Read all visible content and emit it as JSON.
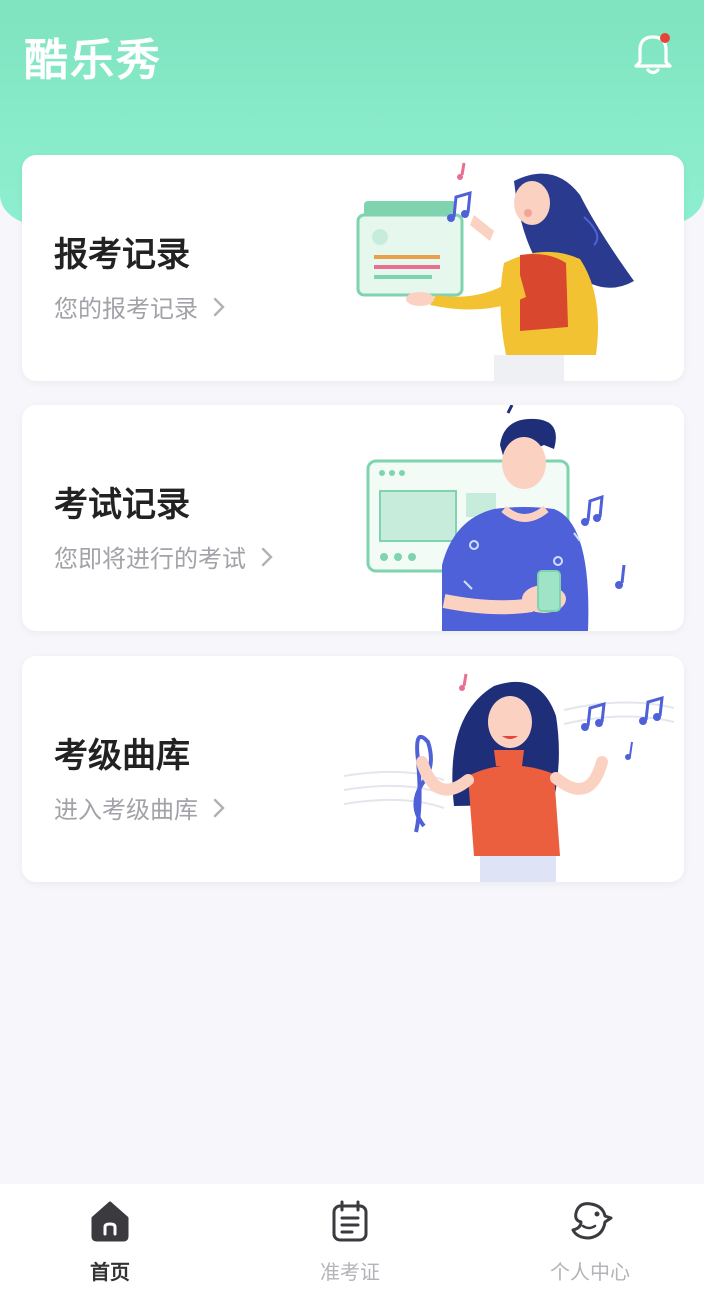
{
  "header": {
    "app_title": "酷乐秀",
    "bell_has_notification": true
  },
  "cards": [
    {
      "title": "报考记录",
      "subtitle": "您的报考记录"
    },
    {
      "title": "考试记录",
      "subtitle": "您即将进行的考试"
    },
    {
      "title": "考级曲库",
      "subtitle": "进入考级曲库"
    }
  ],
  "tabbar": {
    "tabs": [
      {
        "label": "首页",
        "icon": "home-icon",
        "active": true
      },
      {
        "label": "准考证",
        "icon": "admission-ticket-icon",
        "active": false
      },
      {
        "label": "个人中心",
        "icon": "bird-profile-icon",
        "active": false
      }
    ]
  },
  "colors": {
    "header_green": "#88ebc9",
    "accent_red": "#e8443a"
  }
}
